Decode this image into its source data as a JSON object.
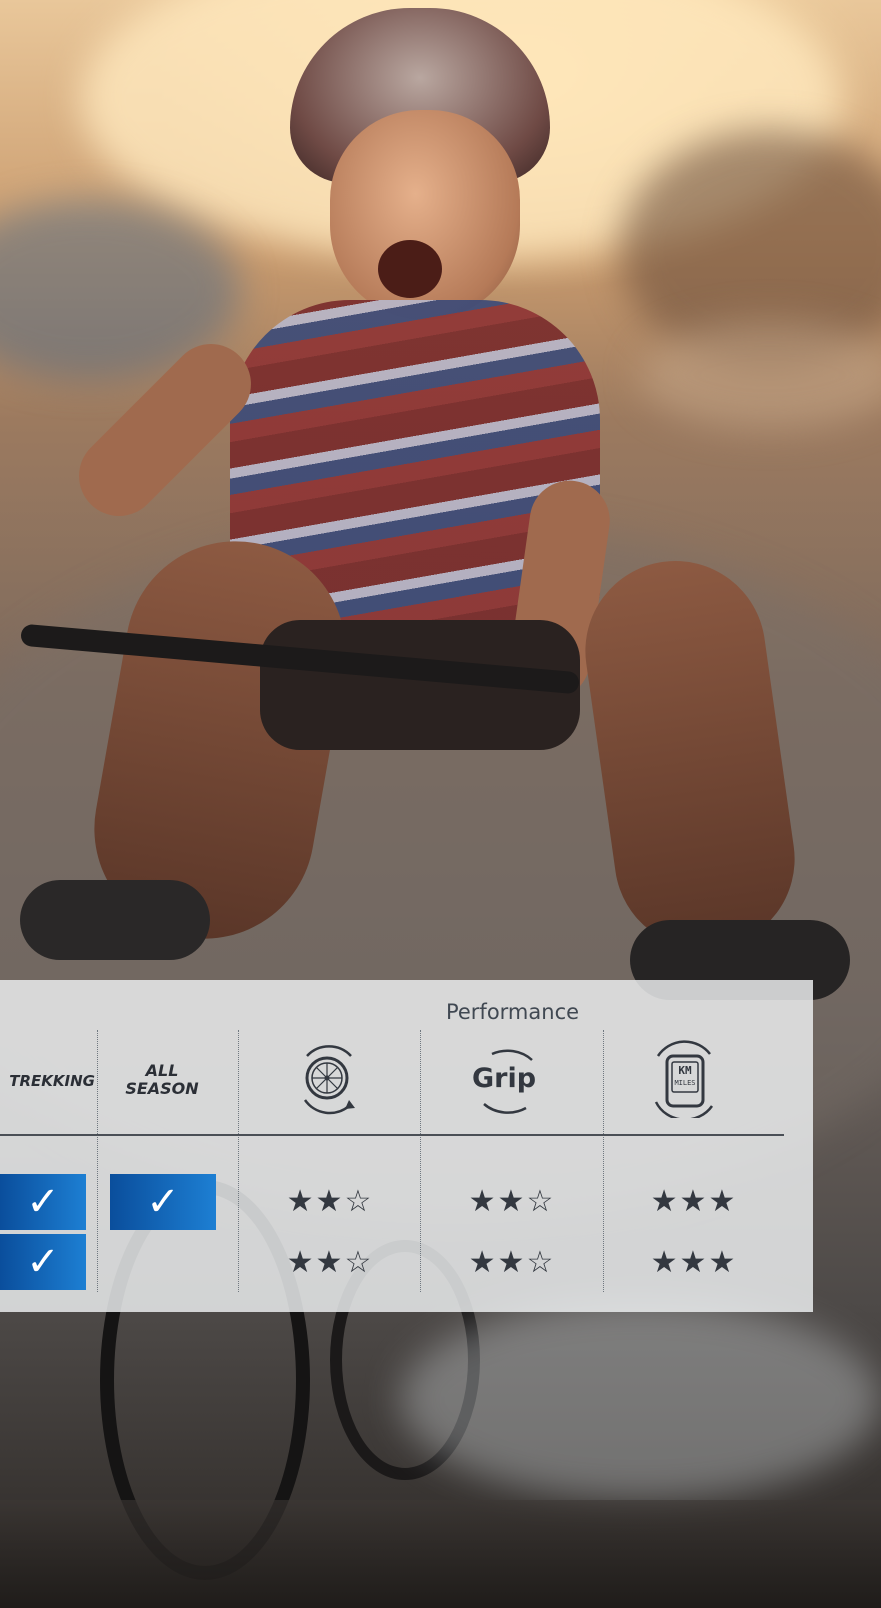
{
  "panel": {
    "performance_label": "Performance",
    "columns": {
      "trekking": "TREKKING",
      "all_season_line1": "ALL",
      "all_season_line2": "SEASON",
      "grip_label": "Grip",
      "km_label": "KM",
      "miles_label": "MILES"
    },
    "check_glyph": "✓",
    "rows": [
      {
        "trekking_checked": true,
        "all_season_checked": true,
        "rolling_stars": "★★☆",
        "grip_stars": "★★☆",
        "mileage_stars": "★★★",
        "rolling_rating": 2,
        "grip_rating": 2,
        "mileage_rating": 3
      },
      {
        "trekking_checked": true,
        "all_season_checked": false,
        "rolling_stars": "★★☆",
        "grip_stars": "★★☆",
        "mileage_stars": "★★★",
        "rolling_rating": 2,
        "grip_rating": 2,
        "mileage_rating": 3
      }
    ],
    "colors": {
      "check_blue": "#1565c0",
      "panel_bg": "#eceef0",
      "text_dark": "#2b2f36"
    },
    "icons": [
      "rolling-resistance-icon",
      "grip-icon",
      "mileage-icon"
    ]
  }
}
